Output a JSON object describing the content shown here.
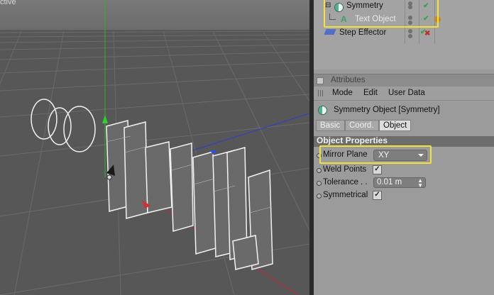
{
  "viewport": {
    "label": "ctive"
  },
  "object_manager": {
    "objects": [
      {
        "name": "Symmetry",
        "icon": "symmetry-icon"
      },
      {
        "name": "Text Object",
        "icon": "text-object-icon"
      },
      {
        "name": "Step Effector",
        "icon": "step-effector-icon"
      }
    ]
  },
  "attributes": {
    "header": "Attributes",
    "menu": [
      "Mode",
      "Edit",
      "User Data"
    ],
    "object_title": "Symmetry Object [Symmetry]",
    "tabs": [
      "Basic",
      "Coord.",
      "Object"
    ],
    "active_tab": "Object",
    "section": "Object Properties",
    "mirror_plane": {
      "label": "Mirror Plane",
      "value": "XY"
    },
    "weld_points": {
      "label": "Weld Points",
      "checked": true
    },
    "tolerance": {
      "label": "Tolerance . .",
      "value": "0.01 m"
    },
    "symmetrical": {
      "label": "Symmetrical",
      "checked": true
    }
  },
  "colors": {
    "highlight": "#f1e23a",
    "viewport_bg": "#585858",
    "panel_bg": "#9b9b9b"
  }
}
